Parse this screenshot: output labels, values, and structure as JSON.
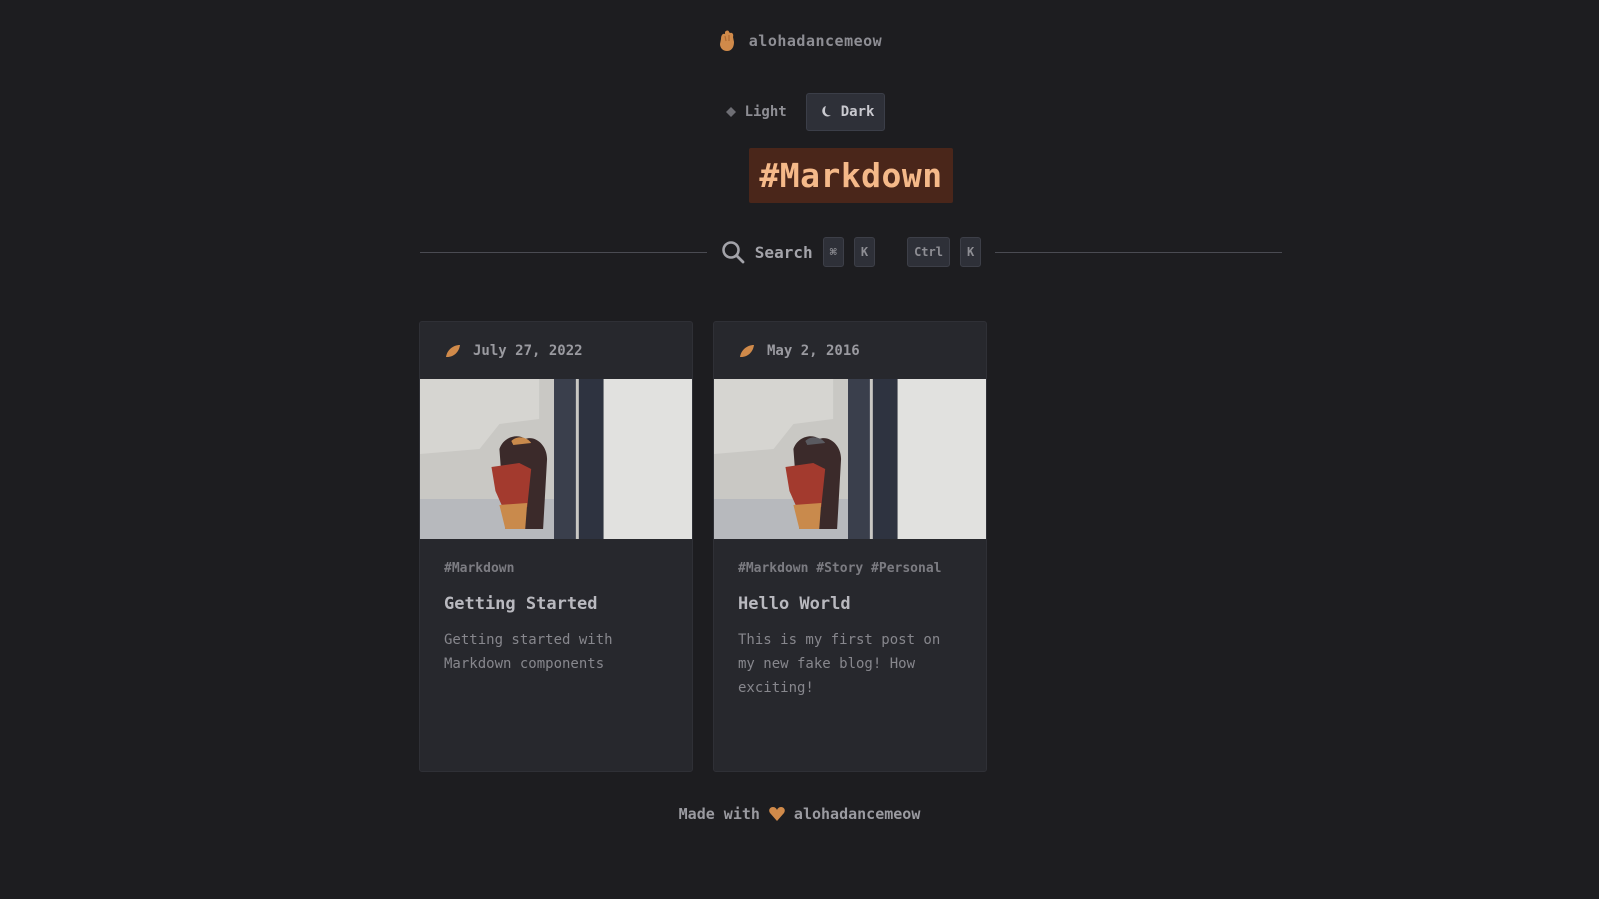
{
  "header": {
    "brand": "alohadancemeow"
  },
  "theme_toggle": {
    "light_label": "Light",
    "dark_label": "Dark",
    "active": "dark"
  },
  "page_title": "#Markdown",
  "search": {
    "label": "Search",
    "shortcut_mac": [
      "⌘",
      "K"
    ],
    "shortcut_other": [
      "Ctrl",
      "K"
    ]
  },
  "posts": [
    {
      "date": "July 27, 2022",
      "tags": "#Markdown",
      "title": "Getting Started",
      "excerpt": "Getting started with Markdown components"
    },
    {
      "date": "May 2, 2016",
      "tags": "#Markdown #Story #Personal",
      "title": "Hello World",
      "excerpt": "This is my first post on my new fake blog! How exciting!"
    }
  ],
  "footer": {
    "prefix": "Made with",
    "suffix": "alohadancemeow"
  },
  "colors": {
    "accent": "#d08a4a",
    "title_bg": "#4a261a",
    "title_text": "#f5b989",
    "background": "#1d1d20",
    "card": "#27282d"
  },
  "icons": {
    "brand": "hand-logo-icon",
    "light": "sun-icon",
    "dark": "moon-icon",
    "search": "search-icon",
    "date": "leaf-icon",
    "footer": "heart-icon"
  }
}
